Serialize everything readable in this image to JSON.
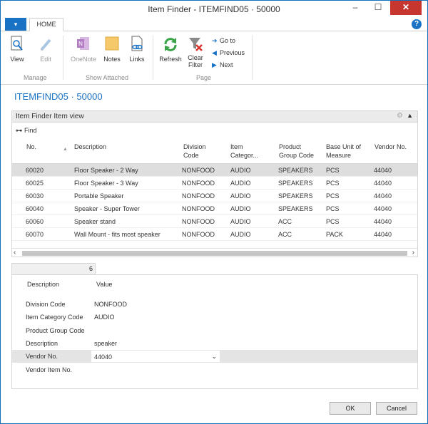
{
  "window": {
    "title": "Item Finder - ITEMFIND05 · 50000",
    "minimize": "–",
    "maximize": "☐",
    "close": "✕"
  },
  "ribbon": {
    "app_button": "▾",
    "tab": "HOME",
    "help": "?",
    "buttons": {
      "view": "View",
      "edit": "Edit",
      "onenote": "OneNote",
      "notes": "Notes",
      "links": "Links",
      "refresh": "Refresh",
      "clear_filter_1": "Clear",
      "clear_filter_2": "Filter",
      "goto": "Go to",
      "previous": "Previous",
      "next": "Next"
    },
    "groups": {
      "manage": "Manage",
      "show_attached": "Show Attached",
      "page": "Page"
    },
    "icons": {
      "view": "magnifier-page-icon",
      "edit": "pencil-icon",
      "onenote": "onenote-icon",
      "notes": "note-icon",
      "links": "link-page-icon",
      "refresh": "refresh-icon",
      "clear_filter": "clear-filter-icon"
    }
  },
  "page_heading": "ITEMFIND05 · 50000",
  "part": {
    "caption": "Item Finder Item view",
    "find": "Find",
    "columns": {
      "no": "No.",
      "description": "Description",
      "division_1": "Division",
      "division_2": "Code",
      "item_cat_1": "Item",
      "item_cat_2": "Categor...",
      "product_group_1": "Product",
      "product_group_2": "Group Code",
      "base_unit_1": "Base Unit of",
      "base_unit_2": "Measure",
      "vendor": "Vendor No."
    },
    "rows": [
      {
        "no": "60020",
        "description": "Floor Speaker - 2 Way",
        "division": "NONFOOD",
        "item_cat": "AUDIO",
        "product_group": "SPEAKERS",
        "uom": "PCS",
        "vendor": "44040",
        "selected": true
      },
      {
        "no": "60025",
        "description": "Floor Speaker - 3 Way",
        "division": "NONFOOD",
        "item_cat": "AUDIO",
        "product_group": "SPEAKERS",
        "uom": "PCS",
        "vendor": "44040"
      },
      {
        "no": "60030",
        "description": "Portable Speaker",
        "division": "NONFOOD",
        "item_cat": "AUDIO",
        "product_group": "SPEAKERS",
        "uom": "PCS",
        "vendor": "44040"
      },
      {
        "no": "60040",
        "description": "Speaker - Super Tower",
        "division": "NONFOOD",
        "item_cat": "AUDIO",
        "product_group": "SPEAKERS",
        "uom": "PCS",
        "vendor": "44040"
      },
      {
        "no": "60060",
        "description": "Speaker stand",
        "division": "NONFOOD",
        "item_cat": "AUDIO",
        "product_group": "ACC",
        "uom": "PCS",
        "vendor": "44040"
      },
      {
        "no": "60070",
        "description": "Wall Mount - fits most speaker",
        "division": "NONFOOD",
        "item_cat": "AUDIO",
        "product_group": "ACC",
        "uom": "PACK",
        "vendor": "44040"
      }
    ]
  },
  "counter": "6",
  "detail": {
    "header_description": "Description",
    "header_value": "Value",
    "rows": [
      {
        "label": "Division Code",
        "value": "NONFOOD"
      },
      {
        "label": "Item Category Code",
        "value": "AUDIO"
      },
      {
        "label": "Product Group Code",
        "value": ""
      },
      {
        "label": "Description",
        "value": "speaker"
      },
      {
        "label": "Vendor No.",
        "value": "44040",
        "active": true
      },
      {
        "label": "Vendor Item No.",
        "value": ""
      }
    ]
  },
  "buttons": {
    "ok": "OK",
    "cancel": "Cancel"
  },
  "colors": {
    "accent": "#1a72c5",
    "selected_row": "#dedede"
  }
}
